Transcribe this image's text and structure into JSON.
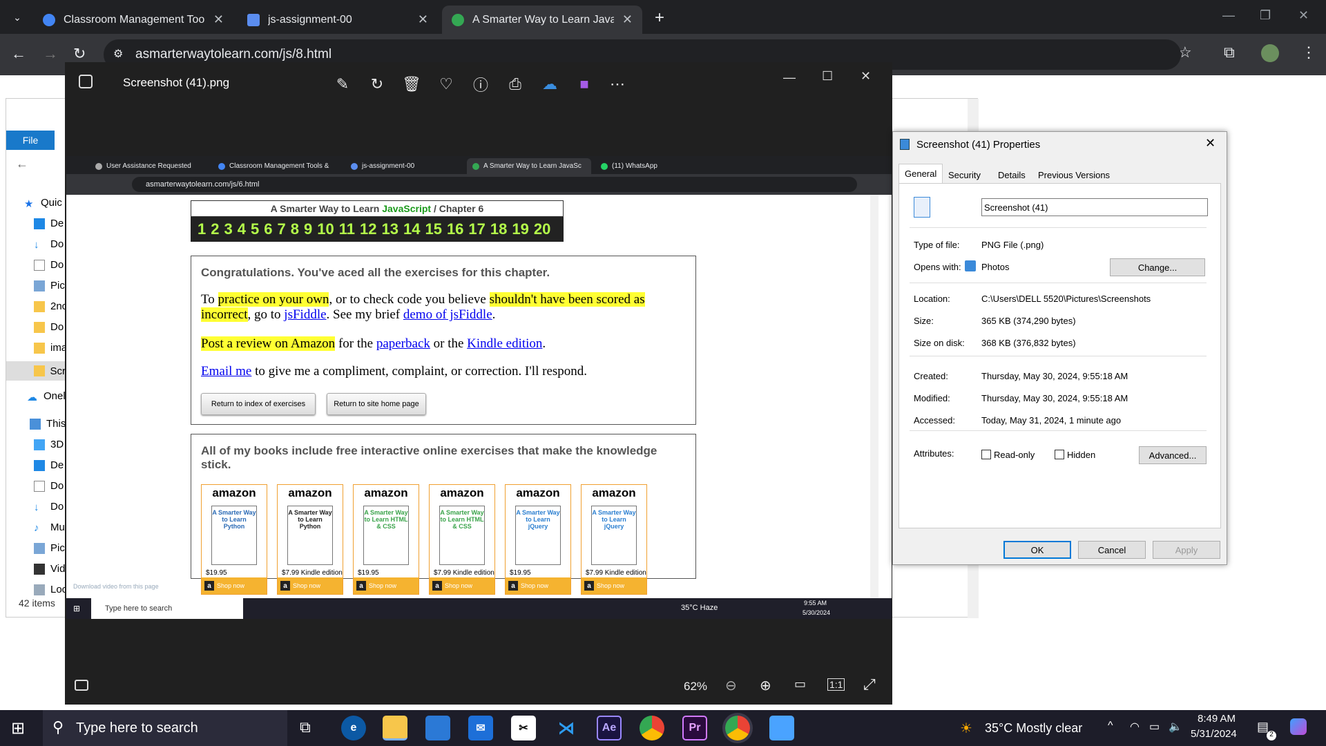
{
  "browser": {
    "tabs": [
      {
        "title": "Classroom Management Tools &",
        "favicon_color": "#4285f4"
      },
      {
        "title": "js-assignment-00",
        "favicon_color": "#5b8def"
      },
      {
        "title": "A Smarter Way to Learn JavaScr",
        "favicon_color": "#34a853"
      }
    ],
    "url": "asmarterwaytolearn.com/js/8.html"
  },
  "explorer": {
    "file_tab": "File",
    "nav": [
      "Quic",
      "De",
      "Do",
      "Do",
      "Pic",
      "2nc",
      "Do",
      "ima",
      "Scr",
      "Onel",
      "This",
      "3D",
      "De",
      "Do",
      "Do",
      "Mu",
      "Pic",
      "Vid",
      "Loc"
    ],
    "item_count": "42 items"
  },
  "photos": {
    "title": "Screenshot (41).png",
    "zoom": "62%",
    "inner": {
      "tabs": [
        "User Assistance Requested",
        "Classroom Management Tools &",
        "js-assignment-00",
        "A Smarter Way to Learn JavaSc",
        "(11) WhatsApp"
      ],
      "url": "asmarterwaytolearn.com/js/6.html",
      "page": {
        "header_prefix": "A Smarter Way to Learn ",
        "header_brand": "JavaScript",
        "header_suffix": " / Chapter 6",
        "chapters": [
          "1",
          "2",
          "3",
          "4",
          "5",
          "6",
          "7",
          "8",
          "9",
          "10",
          "11",
          "12",
          "13",
          "14",
          "15",
          "16",
          "17",
          "18",
          "19",
          "20"
        ],
        "congrats": "Congratulations. You've aced all the exercises for this chapter.",
        "p1": {
          "a": "To ",
          "b": "practice on your own",
          "c": ", or to check code you believe ",
          "d": "shouldn't have been scored as",
          "e": "incorrect",
          "f": ", go to ",
          "g": "jsFiddle",
          "h": ". See my brief ",
          "i": "demo of jsFiddle",
          "j": "."
        },
        "p2": {
          "a": "Post a review on Amazon",
          "b": " for the ",
          "c": "paperback",
          "d": " or the ",
          "e": "Kindle edition",
          "f": "."
        },
        "p3": {
          "a": "Email me",
          "b": " to give me a compliment, complaint, or correction. I'll respond."
        },
        "btn_index": "Return to index of exercises",
        "btn_home": "Return to site home page",
        "books_heading": "All of my books include free interactive online exercises that make the knowledge stick.",
        "books": [
          {
            "title": "A Smarter Way to Learn Python",
            "price": "$19.95",
            "color": "#2a6ab5"
          },
          {
            "title": "A Smarter Way to Learn Python",
            "price": "$7.99 Kindle edition",
            "color": "#222"
          },
          {
            "title": "A Smarter Way to Learn HTML & CSS",
            "price": "$19.95",
            "color": "#3aa34a"
          },
          {
            "title": "A Smarter Way to Learn HTML & CSS",
            "price": "$7.99 Kindle edition",
            "color": "#3aa34a"
          },
          {
            "title": "A Smarter Way to Learn jQuery",
            "price": "$19.95",
            "color": "#2b7fd0"
          },
          {
            "title": "A Smarter Way to Learn jQuery",
            "price": "$7.99 Kindle edition",
            "color": "#2b7fd0"
          }
        ],
        "amazon": "amazon",
        "shop": "Shop now",
        "download_hint": "Download video from this page"
      },
      "taskbar": {
        "search": "Type here to search",
        "weather": "35°C  Haze",
        "time": "9:55 AM",
        "date": "5/30/2024"
      }
    }
  },
  "props": {
    "title": "Screenshot (41) Properties",
    "tabs": [
      "General",
      "Security",
      "Details",
      "Previous Versions"
    ],
    "filename": "Screenshot (41)",
    "type_label": "Type of file:",
    "type_value": "PNG File (.png)",
    "opens_label": "Opens with:",
    "opens_value": "Photos",
    "change_btn": "Change...",
    "location_label": "Location:",
    "location_value": "C:\\Users\\DELL 5520\\Pictures\\Screenshots",
    "size_label": "Size:",
    "size_value": "365 KB (374,290 bytes)",
    "disk_label": "Size on disk:",
    "disk_value": "368 KB (376,832 bytes)",
    "created_label": "Created:",
    "created_value": "Thursday, May 30, 2024, 9:55:18 AM",
    "modified_label": "Modified:",
    "modified_value": "Thursday, May 30, 2024, 9:55:18 AM",
    "accessed_label": "Accessed:",
    "accessed_value": "Today, May 31, 2024, 1 minute ago",
    "attr_label": "Attributes:",
    "readonly": "Read-only",
    "hidden": "Hidden",
    "advanced_btn": "Advanced...",
    "ok": "OK",
    "cancel": "Cancel",
    "apply": "Apply"
  },
  "taskbar": {
    "search": "Type here to search",
    "weather": "35°C  Mostly clear",
    "time": "8:49 AM",
    "date": "5/31/2024",
    "notif_count": "2"
  }
}
